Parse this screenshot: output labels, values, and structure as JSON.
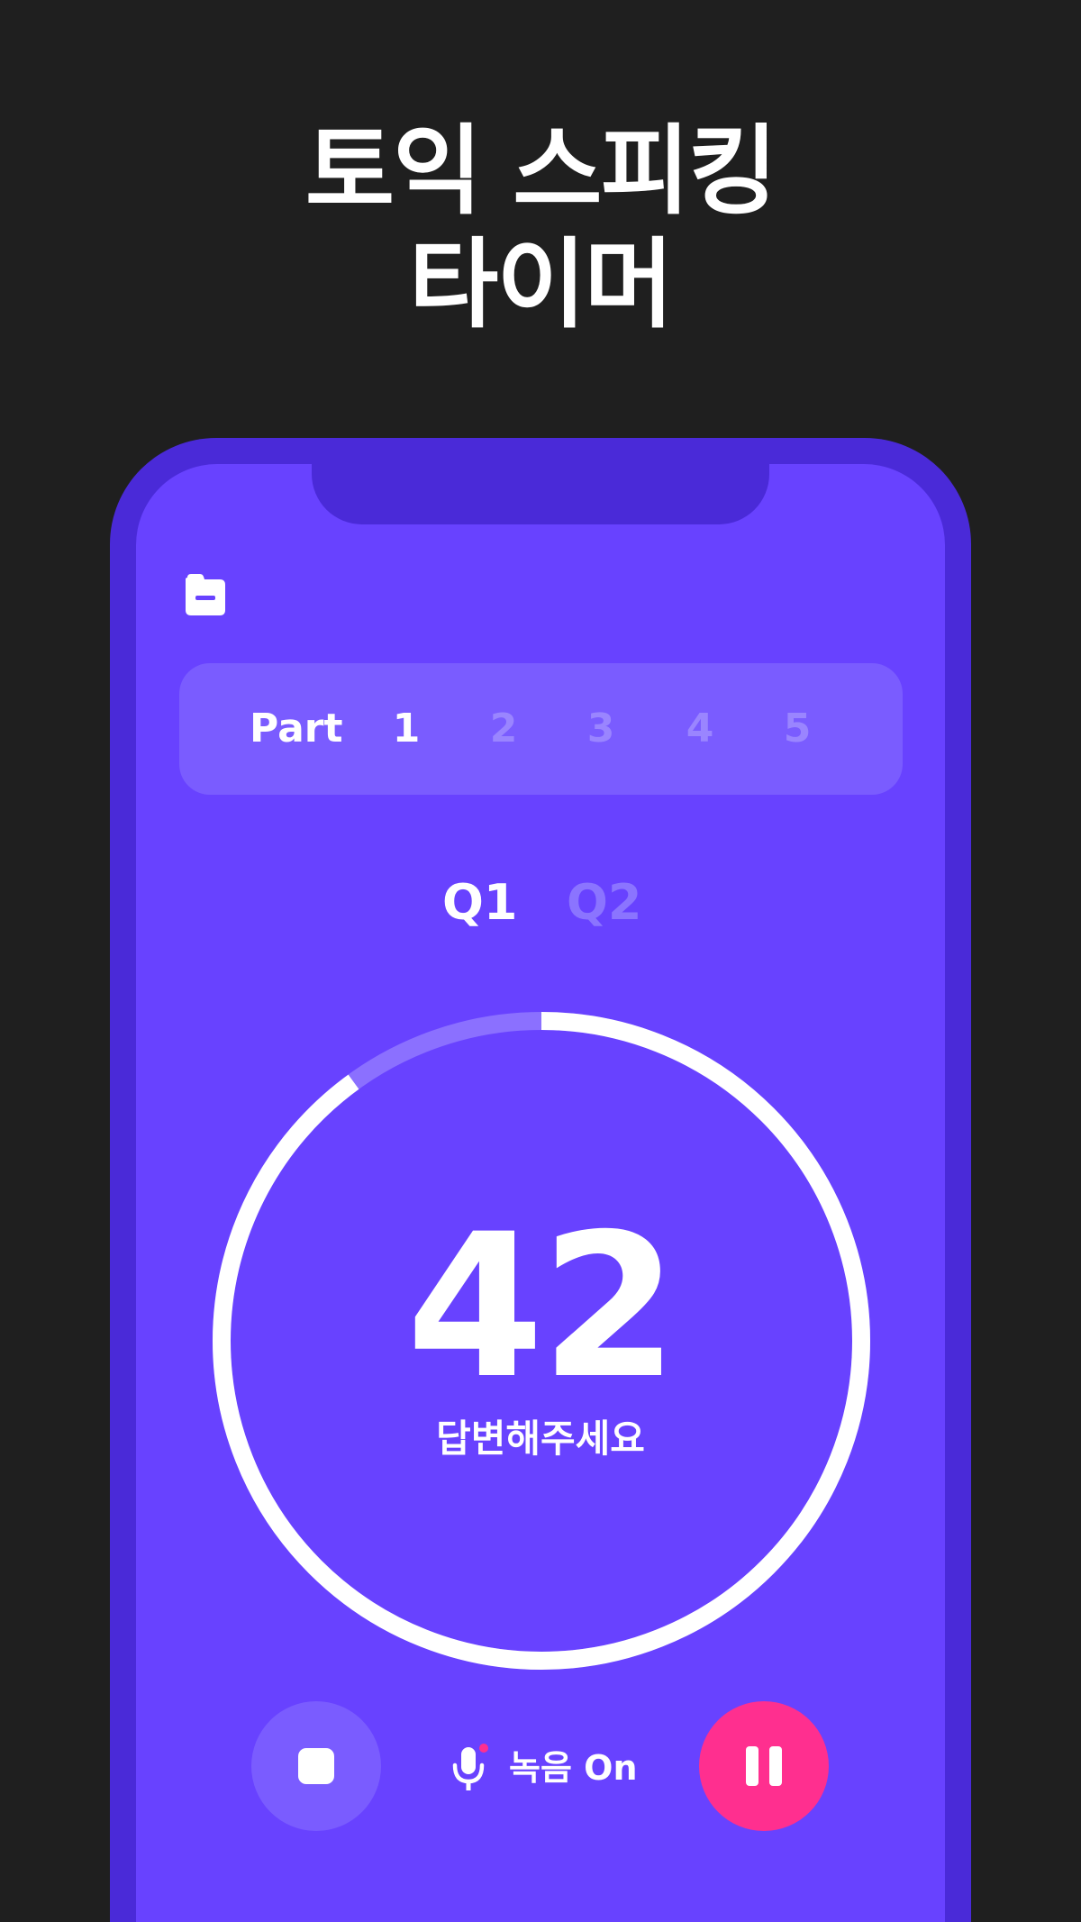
{
  "headline": {
    "line1": "토익 스피킹",
    "line2": "타이머"
  },
  "colors": {
    "page_background": "#1f1f1f",
    "phone_frame": "#4a2ad8",
    "screen_background": "#6842ff",
    "selector_background": "#7a5cff",
    "inactive_text": "#9a85ff",
    "record_dot": "#ff2f8f",
    "pause_button": "#ff2f8f"
  },
  "top_bar": {
    "icon": "folder-icon"
  },
  "part_selector": {
    "label": "Part",
    "parts": [
      "1",
      "2",
      "3",
      "4",
      "5"
    ],
    "selected": "1"
  },
  "question_tabs": {
    "tabs": [
      "Q1",
      "Q2"
    ],
    "selected": "Q1"
  },
  "timer": {
    "value": "42",
    "caption": "답변해주세요",
    "progress_fraction_remaining": 0.9
  },
  "controls": {
    "stop_icon": "stop-icon",
    "record_icon": "microphone-icon",
    "record_label": "녹음 On",
    "pause_icon": "pause-icon"
  }
}
